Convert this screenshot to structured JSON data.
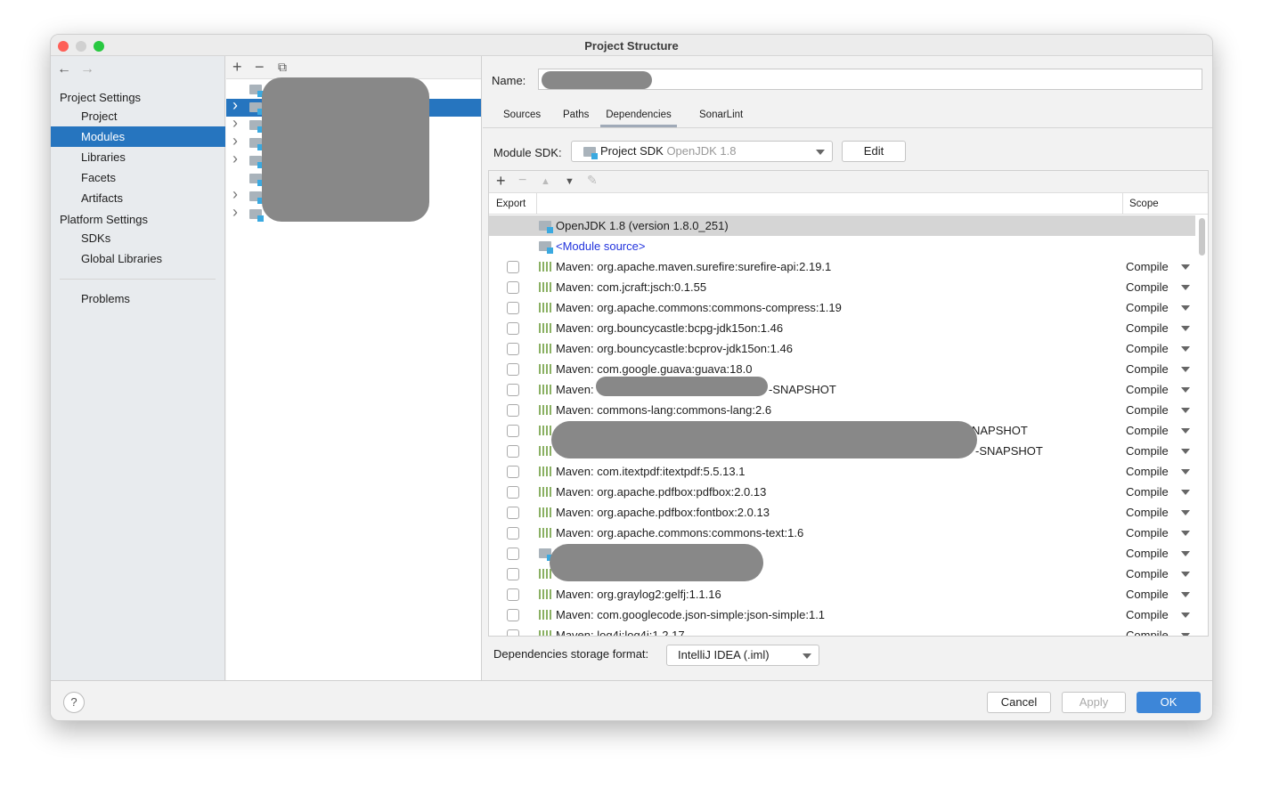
{
  "window": {
    "title": "Project Structure"
  },
  "sidebar": {
    "sections": [
      {
        "label": "Project Settings",
        "items": [
          "Project",
          "Modules",
          "Libraries",
          "Facets",
          "Artifacts"
        ]
      },
      {
        "label": "Platform Settings",
        "items": [
          "SDKs",
          "Global Libraries"
        ]
      }
    ],
    "problems": "Problems",
    "selected": "Modules"
  },
  "modules": {
    "rows": [
      {
        "expandable": false
      },
      {
        "expandable": true,
        "selected": true
      },
      {
        "expandable": true
      },
      {
        "expandable": true
      },
      {
        "expandable": true
      },
      {
        "expandable": false
      },
      {
        "expandable": true
      },
      {
        "expandable": true
      }
    ]
  },
  "detail": {
    "name_label": "Name:",
    "tabs": [
      "Sources",
      "Paths",
      "Dependencies",
      "SonarLint"
    ],
    "active_tab": "Dependencies",
    "sdk_label": "Module SDK:",
    "sdk_value": "Project SDK",
    "sdk_version": "OpenJDK 1.8",
    "edit": "Edit",
    "columns": {
      "export": "Export",
      "scope": "Scope"
    },
    "deps": [
      {
        "type": "sdk",
        "text": "OpenJDK 1.8 (version 1.8.0_251)",
        "selected": true
      },
      {
        "type": "source",
        "text": "<Module source>"
      },
      {
        "type": "maven",
        "text": "Maven: org.apache.maven.surefire:surefire-api:2.19.1",
        "scope": "Compile"
      },
      {
        "type": "maven",
        "text": "Maven: com.jcraft:jsch:0.1.55",
        "scope": "Compile"
      },
      {
        "type": "maven",
        "text": "Maven: org.apache.commons:commons-compress:1.19",
        "scope": "Compile"
      },
      {
        "type": "maven",
        "text": "Maven: org.bouncycastle:bcpg-jdk15on:1.46",
        "scope": "Compile"
      },
      {
        "type": "maven",
        "text": "Maven: org.bouncycastle:bcprov-jdk15on:1.46",
        "scope": "Compile"
      },
      {
        "type": "maven",
        "text": "Maven: com.google.guava:guava:18.0",
        "scope": "Compile"
      },
      {
        "type": "maven",
        "text": "Maven:",
        "suffix": "-SNAPSHOT",
        "scope": "Compile"
      },
      {
        "type": "maven",
        "text": "Maven: commons-lang:commons-lang:2.6",
        "scope": "Compile"
      },
      {
        "type": "maven",
        "text": "",
        "suffix": "NAPSHOT",
        "scope": "Compile"
      },
      {
        "type": "maven",
        "text": "",
        "suffix": "-SNAPSHOT",
        "scope": "Compile"
      },
      {
        "type": "maven",
        "text": "Maven: com.itextpdf:itextpdf:5.5.13.1",
        "scope": "Compile"
      },
      {
        "type": "maven",
        "text": "Maven: org.apache.pdfbox:pdfbox:2.0.13",
        "scope": "Compile"
      },
      {
        "type": "maven",
        "text": "Maven: org.apache.pdfbox:fontbox:2.0.13",
        "scope": "Compile"
      },
      {
        "type": "maven",
        "text": "Maven: org.apache.commons:commons-text:1.6",
        "scope": "Compile"
      },
      {
        "type": "module",
        "text": "",
        "scope": "Compile"
      },
      {
        "type": "maven",
        "text": "",
        "scope": "Compile"
      },
      {
        "type": "maven",
        "text": "Maven: org.graylog2:gelfj:1.1.16",
        "scope": "Compile"
      },
      {
        "type": "maven",
        "text": "Maven: com.googlecode.json-simple:json-simple:1.1",
        "scope": "Compile"
      },
      {
        "type": "maven",
        "text": "Maven: log4j:log4j:1.2.17",
        "scope": "Compile"
      }
    ],
    "storage_label": "Dependencies storage format:",
    "storage_value": "IntelliJ IDEA (.iml)"
  },
  "footer": {
    "help": "?",
    "cancel": "Cancel",
    "apply": "Apply",
    "ok": "OK"
  },
  "colors": {
    "accent": "#2675bf",
    "ok": "#3d86d8",
    "link": "#2233dd",
    "maven": "#8ab063",
    "redaction": "#888888"
  }
}
